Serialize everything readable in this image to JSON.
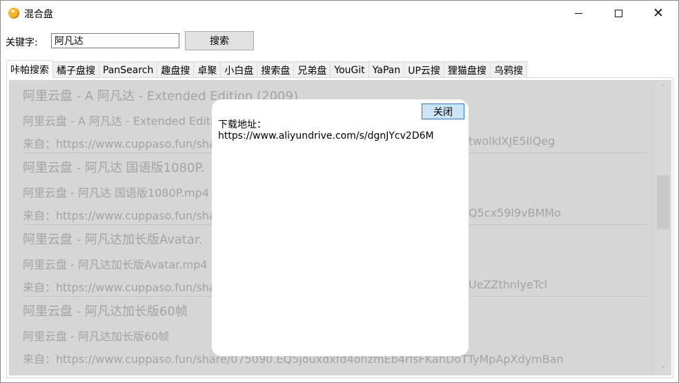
{
  "window": {
    "title": "混合盘",
    "minimize_icon": "minimize-icon",
    "maximize_icon": "maximize-icon",
    "close_icon": "close-icon",
    "close_glyph": "✕"
  },
  "search": {
    "label": "关键字:",
    "value": "阿凡达",
    "button_label": "搜索"
  },
  "tabs": [
    {
      "label": "咔帕搜索",
      "active": true
    },
    {
      "label": "橘子盘搜"
    },
    {
      "label": "PanSearch"
    },
    {
      "label": "趣盘搜"
    },
    {
      "label": "卓聚"
    },
    {
      "label": "小白盘"
    },
    {
      "label": "搜索盘"
    },
    {
      "label": "兄弟盘"
    },
    {
      "label": "YouGit"
    },
    {
      "label": "YaPan"
    },
    {
      "label": "UP云搜"
    },
    {
      "label": "狸猫盘搜"
    },
    {
      "label": "乌鸦搜"
    }
  ],
  "results": [
    {
      "title": "阿里云盘 - A 阿凡达 - Extended Edition (2009)",
      "subtitle": "阿里云盘 - A 阿凡达 - Extended Editi",
      "source_prefix": "来自：https://www.cuppaso.fun/sha",
      "source_tail": "twolkIXJE5IlQeg"
    },
    {
      "title": "阿里云盘 - 阿凡达 国语版1080P.",
      "subtitle": "阿里云盘 - 阿凡达 国语版1080P.mp4",
      "source_prefix": "来自：https://www.cuppaso.fun/sha",
      "source_tail": "Q5cx59l9vBMMo"
    },
    {
      "title": "阿里云盘 - 阿凡达加长版Avatar.",
      "subtitle": "阿里云盘 - 阿凡达加长版Avatar.mp4",
      "source_prefix": "来自：https://www.cuppaso.fun/sha",
      "source_tail": "UeZZthnlyeTcl"
    },
    {
      "title": "阿里云盘 - 阿凡达加长版60帧",
      "subtitle": "阿里云盘 - 阿凡达加长版60帧",
      "source_prefix": "来自：https://www.cuppaso.fun/share/075090.EQ5jouxdxfd4ohzmEb4rIsFKahDoTTyMpApXdymBan",
      "source_tail": ""
    }
  ],
  "dialog": {
    "close_label": "关闭",
    "label": "下载地址：",
    "url": "https://www.aliyundrive.com/s/dgnJYcv2D6M"
  },
  "scrollbar": {
    "up_glyph": "⌃",
    "down_glyph": "⌄"
  }
}
